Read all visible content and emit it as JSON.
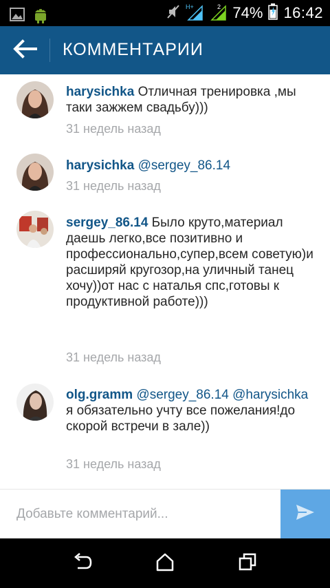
{
  "status_bar": {
    "battery_percent": "74%",
    "time": "16:42",
    "network_type": "H+",
    "icons": [
      "gallery-icon",
      "android-icon",
      "mute-icon",
      "signal-icon",
      "signal-2-icon",
      "battery-icon"
    ]
  },
  "app_bar": {
    "title": "КОММЕНТАРИИ",
    "color": "#125688"
  },
  "comments": [
    {
      "username": "harysichka",
      "text": "Отличная тренировка ,мы таки зажжем свадьбу)))",
      "mention": "",
      "time": "31 недель назад"
    },
    {
      "username": "harysichka",
      "text": "",
      "mention": "@sergey_86.14",
      "time": "31 недель назад"
    },
    {
      "username": "sergey_86.14",
      "text": "Было круто,материал даешь легко,все позитивно и профессионально,супер,всем советую)и расширяй кругозор,на уличный танец хочу))от нас с наталья спс,готовы к продуктивной работе)))",
      "mention": "",
      "time": "31 недель назад"
    },
    {
      "username": "olg.gramm",
      "mention": "@sergey_86.14",
      "mention2": "@harysichka",
      "text": "я обязательно учту все пожелания!до скорой встречи в зале))",
      "time": "31 недель назад"
    }
  ],
  "input": {
    "placeholder": "Добавьте комментарий..."
  },
  "colors": {
    "accent": "#125688",
    "send": "#5ea7e4",
    "muted": "#a5a7aa"
  }
}
